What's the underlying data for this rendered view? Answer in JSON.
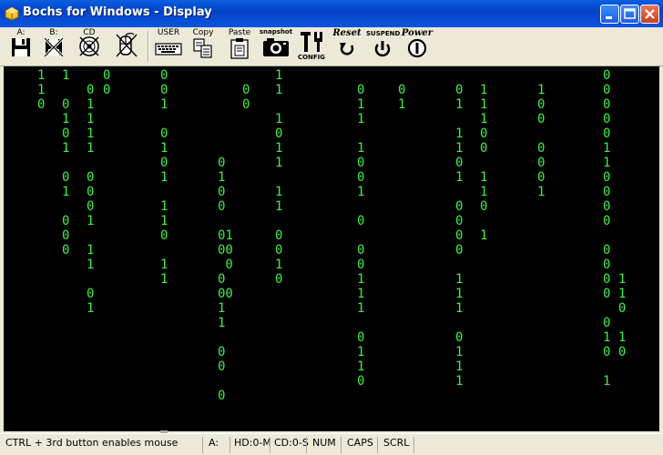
{
  "window": {
    "title": "Bochs for Windows - Display",
    "icon": "bochs-app-icon",
    "controls": [
      "minimize-icon",
      "maximize-icon",
      "close-icon"
    ]
  },
  "toolbar": {
    "buttons": [
      {
        "id": "floppy-a",
        "label": "A:",
        "icon": "floppy-disk-icon"
      },
      {
        "id": "floppy-b",
        "label": "B:",
        "icon": "floppy-disk-disabled-icon"
      },
      {
        "id": "cdrom",
        "label": "CD",
        "icon": "cdrom-disabled-icon"
      },
      {
        "id": "mouse",
        "label": "",
        "icon": "mouse-disabled-icon"
      },
      {
        "id": "user",
        "label": "USER",
        "icon": "keyboard-icon"
      },
      {
        "id": "copy",
        "label": "Copy",
        "icon": "copy-icon"
      },
      {
        "id": "paste",
        "label": "Paste",
        "icon": "paste-icon"
      },
      {
        "id": "snapshot",
        "label": "snapshot",
        "icon": "camera-icon"
      },
      {
        "id": "config",
        "label": "CONFIG",
        "icon": "config-tools-icon"
      },
      {
        "id": "reset",
        "label": "Reset",
        "icon": "reset-arrow-icon"
      },
      {
        "id": "suspend",
        "label": "SUSPEND",
        "icon": "suspend-icon"
      },
      {
        "id": "power",
        "label": "Power",
        "icon": "power-icon"
      }
    ]
  },
  "display": {
    "text_color": "#3cf046",
    "background": "#000000",
    "columns": [
      {
        "cells": [
          {
            "row": 0,
            "text": "1"
          },
          {
            "row": 1,
            "text": "1"
          },
          {
            "row": 2,
            "text": "0"
          }
        ]
      },
      {
        "cells": [
          {
            "row": 0,
            "text": "1"
          },
          {
            "row": 2,
            "text": "0"
          },
          {
            "row": 3,
            "text": "1"
          },
          {
            "row": 4,
            "text": "0"
          },
          {
            "row": 5,
            "text": "1"
          },
          {
            "row": 7,
            "text": "0"
          },
          {
            "row": 8,
            "text": "1"
          },
          {
            "row": 10,
            "text": "0"
          },
          {
            "row": 11,
            "text": "0"
          },
          {
            "row": 12,
            "text": "0"
          }
        ]
      },
      {
        "cells": [
          {
            "row": 1,
            "text": "0"
          },
          {
            "row": 2,
            "text": "1"
          },
          {
            "row": 3,
            "text": "1"
          },
          {
            "row": 4,
            "text": "1"
          },
          {
            "row": 5,
            "text": "1"
          },
          {
            "row": 7,
            "text": "0"
          },
          {
            "row": 8,
            "text": "0"
          },
          {
            "row": 9,
            "text": "0"
          },
          {
            "row": 10,
            "text": "1"
          },
          {
            "row": 12,
            "text": "1"
          },
          {
            "row": 13,
            "text": "1"
          },
          {
            "row": 15,
            "text": "0"
          },
          {
            "row": 16,
            "text": "1"
          }
        ]
      },
      {
        "cells": [
          {
            "row": 0,
            "text": "0"
          },
          {
            "row": 1,
            "text": "0"
          }
        ]
      },
      {
        "cells": [
          {
            "row": 0,
            "text": "0"
          },
          {
            "row": 1,
            "text": "0"
          },
          {
            "row": 2,
            "text": "1"
          },
          {
            "row": 4,
            "text": "0"
          },
          {
            "row": 5,
            "text": "1"
          },
          {
            "row": 6,
            "text": "0"
          },
          {
            "row": 7,
            "text": "1"
          },
          {
            "row": 9,
            "text": "1"
          },
          {
            "row": 10,
            "text": "1"
          },
          {
            "row": 11,
            "text": "0"
          },
          {
            "row": 13,
            "text": "1"
          },
          {
            "row": 14,
            "text": "1"
          }
        ]
      },
      {
        "cells": [
          {
            "row": 6,
            "text": "0"
          },
          {
            "row": 7,
            "text": "1"
          },
          {
            "row": 8,
            "text": "0"
          },
          {
            "row": 9,
            "text": "0"
          },
          {
            "row": 11,
            "text": "01"
          },
          {
            "row": 12,
            "text": "00"
          },
          {
            "row": 13,
            "text": " 0"
          },
          {
            "row": 14,
            "text": "0"
          },
          {
            "row": 15,
            "text": "00"
          },
          {
            "row": 16,
            "text": "1"
          },
          {
            "row": 17,
            "text": "1"
          },
          {
            "row": 19,
            "text": "0"
          },
          {
            "row": 20,
            "text": "0"
          },
          {
            "row": 22,
            "text": "0"
          }
        ]
      },
      {
        "cells": [
          {
            "row": 1,
            "text": "0"
          },
          {
            "row": 2,
            "text": "0"
          }
        ]
      },
      {
        "cells": [
          {
            "row": 0,
            "text": "1"
          },
          {
            "row": 1,
            "text": "1"
          },
          {
            "row": 3,
            "text": "1"
          },
          {
            "row": 4,
            "text": "0"
          },
          {
            "row": 5,
            "text": "1"
          },
          {
            "row": 6,
            "text": "1"
          },
          {
            "row": 8,
            "text": "1"
          },
          {
            "row": 9,
            "text": "1"
          },
          {
            "row": 11,
            "text": "0"
          },
          {
            "row": 12,
            "text": "0"
          },
          {
            "row": 13,
            "text": "1"
          },
          {
            "row": 14,
            "text": "0"
          }
        ]
      },
      {
        "cells": [
          {
            "row": 1,
            "text": "0"
          },
          {
            "row": 2,
            "text": "1"
          },
          {
            "row": 3,
            "text": "1"
          },
          {
            "row": 5,
            "text": "1"
          },
          {
            "row": 6,
            "text": "0"
          },
          {
            "row": 7,
            "text": "0"
          },
          {
            "row": 8,
            "text": "1"
          },
          {
            "row": 10,
            "text": "0"
          },
          {
            "row": 12,
            "text": "0"
          },
          {
            "row": 13,
            "text": "0"
          },
          {
            "row": 14,
            "text": "1"
          },
          {
            "row": 15,
            "text": "1"
          },
          {
            "row": 16,
            "text": "1"
          },
          {
            "row": 18,
            "text": "0"
          },
          {
            "row": 19,
            "text": "1"
          },
          {
            "row": 20,
            "text": "1"
          },
          {
            "row": 21,
            "text": "0"
          }
        ]
      },
      {
        "cells": [
          {
            "row": 1,
            "text": "0"
          },
          {
            "row": 2,
            "text": "1"
          }
        ]
      },
      {
        "cells": [
          {
            "row": 1,
            "text": "0"
          },
          {
            "row": 2,
            "text": "1"
          },
          {
            "row": 4,
            "text": "1"
          },
          {
            "row": 5,
            "text": "1"
          },
          {
            "row": 6,
            "text": "0"
          },
          {
            "row": 7,
            "text": "1"
          },
          {
            "row": 9,
            "text": "0"
          },
          {
            "row": 10,
            "text": "0"
          },
          {
            "row": 11,
            "text": "0"
          },
          {
            "row": 12,
            "text": "0"
          },
          {
            "row": 14,
            "text": "1"
          },
          {
            "row": 15,
            "text": "1"
          },
          {
            "row": 16,
            "text": "1"
          },
          {
            "row": 18,
            "text": "0"
          },
          {
            "row": 19,
            "text": "1"
          },
          {
            "row": 20,
            "text": "1"
          },
          {
            "row": 21,
            "text": "1"
          }
        ]
      },
      {
        "cells": [
          {
            "row": 1,
            "text": "1"
          },
          {
            "row": 2,
            "text": "1"
          },
          {
            "row": 3,
            "text": "1"
          },
          {
            "row": 4,
            "text": "0"
          },
          {
            "row": 5,
            "text": "0"
          },
          {
            "row": 7,
            "text": "1"
          },
          {
            "row": 8,
            "text": "1"
          },
          {
            "row": 9,
            "text": "0"
          },
          {
            "row": 11,
            "text": "1"
          }
        ]
      },
      {
        "cells": [
          {
            "row": 1,
            "text": "1"
          },
          {
            "row": 2,
            "text": "0"
          },
          {
            "row": 3,
            "text": "0"
          },
          {
            "row": 5,
            "text": "0"
          },
          {
            "row": 6,
            "text": "0"
          },
          {
            "row": 7,
            "text": "0"
          },
          {
            "row": 8,
            "text": "1"
          }
        ]
      },
      {
        "cells": [
          {
            "row": 0,
            "text": "0"
          },
          {
            "row": 1,
            "text": "0"
          },
          {
            "row": 2,
            "text": "0"
          },
          {
            "row": 3,
            "text": "0"
          },
          {
            "row": 4,
            "text": "0"
          },
          {
            "row": 5,
            "text": "1"
          },
          {
            "row": 6,
            "text": "1"
          },
          {
            "row": 7,
            "text": "0"
          },
          {
            "row": 8,
            "text": "0"
          },
          {
            "row": 9,
            "text": "0"
          },
          {
            "row": 10,
            "text": "0"
          },
          {
            "row": 12,
            "text": "0"
          },
          {
            "row": 13,
            "text": "0"
          },
          {
            "row": 14,
            "text": "0 1"
          },
          {
            "row": 15,
            "text": "0 1"
          },
          {
            "row": 16,
            "text": "  0"
          },
          {
            "row": 17,
            "text": "0"
          },
          {
            "row": 18,
            "text": "1 1"
          },
          {
            "row": 19,
            "text": "0 0"
          },
          {
            "row": 21,
            "text": "1"
          }
        ]
      }
    ]
  },
  "statusbar": {
    "message": "CTRL + 3rd button enables mouse",
    "indicators": [
      "A:",
      "HD:0-M",
      "CD:0-S",
      "NUM",
      "CAPS",
      "SCRL"
    ]
  }
}
